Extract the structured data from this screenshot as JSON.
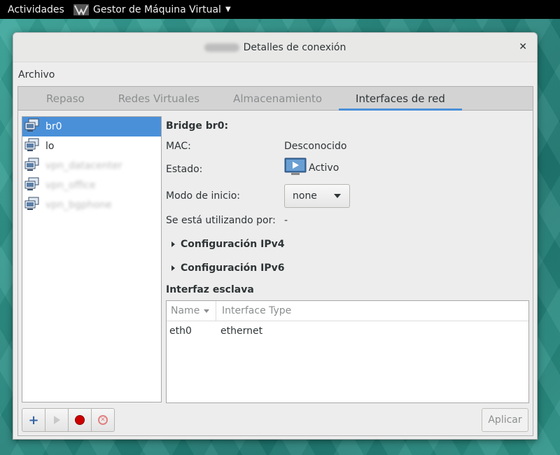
{
  "topbar": {
    "activities": "Actividades",
    "app_name": "Gestor de Máquina Virtual"
  },
  "window": {
    "title": "Detalles de conexión",
    "close_icon": "close-icon"
  },
  "menubar": {
    "archivo": "Archivo"
  },
  "tabs": [
    {
      "label": "Repaso",
      "active": false
    },
    {
      "label": "Redes Virtuales",
      "active": false
    },
    {
      "label": "Almacenamiento",
      "active": false
    },
    {
      "label": "Interfaces de red",
      "active": true
    }
  ],
  "interfaces": [
    {
      "name": "br0",
      "selected": true,
      "blurred": false
    },
    {
      "name": "lo",
      "selected": false,
      "blurred": false
    },
    {
      "name": "vpn_datacenter",
      "selected": false,
      "blurred": true
    },
    {
      "name": "vpn_office",
      "selected": false,
      "blurred": true
    },
    {
      "name": "vpn_bgphone",
      "selected": false,
      "blurred": true
    }
  ],
  "details": {
    "title": "Bridge br0:",
    "mac_label": "MAC:",
    "mac_value": "Desconocido",
    "state_label": "Estado:",
    "state_value": "Activo",
    "start_mode_label": "Modo de inicio:",
    "start_mode_value": "none",
    "used_by_label": "Se está utilizando por:",
    "used_by_value": "-",
    "ipv4_label": "Configuración IPv4",
    "ipv6_label": "Configuración IPv6",
    "slave_title": "Interfaz esclava",
    "slave_columns": [
      "Name",
      "Interface Type"
    ],
    "slave_rows": [
      {
        "name": "eth0",
        "type": "ethernet"
      }
    ],
    "apply_label": "Aplicar"
  },
  "colors": {
    "accent": "#4a90d9",
    "record": "#cc0000",
    "add": "#3465a4"
  }
}
